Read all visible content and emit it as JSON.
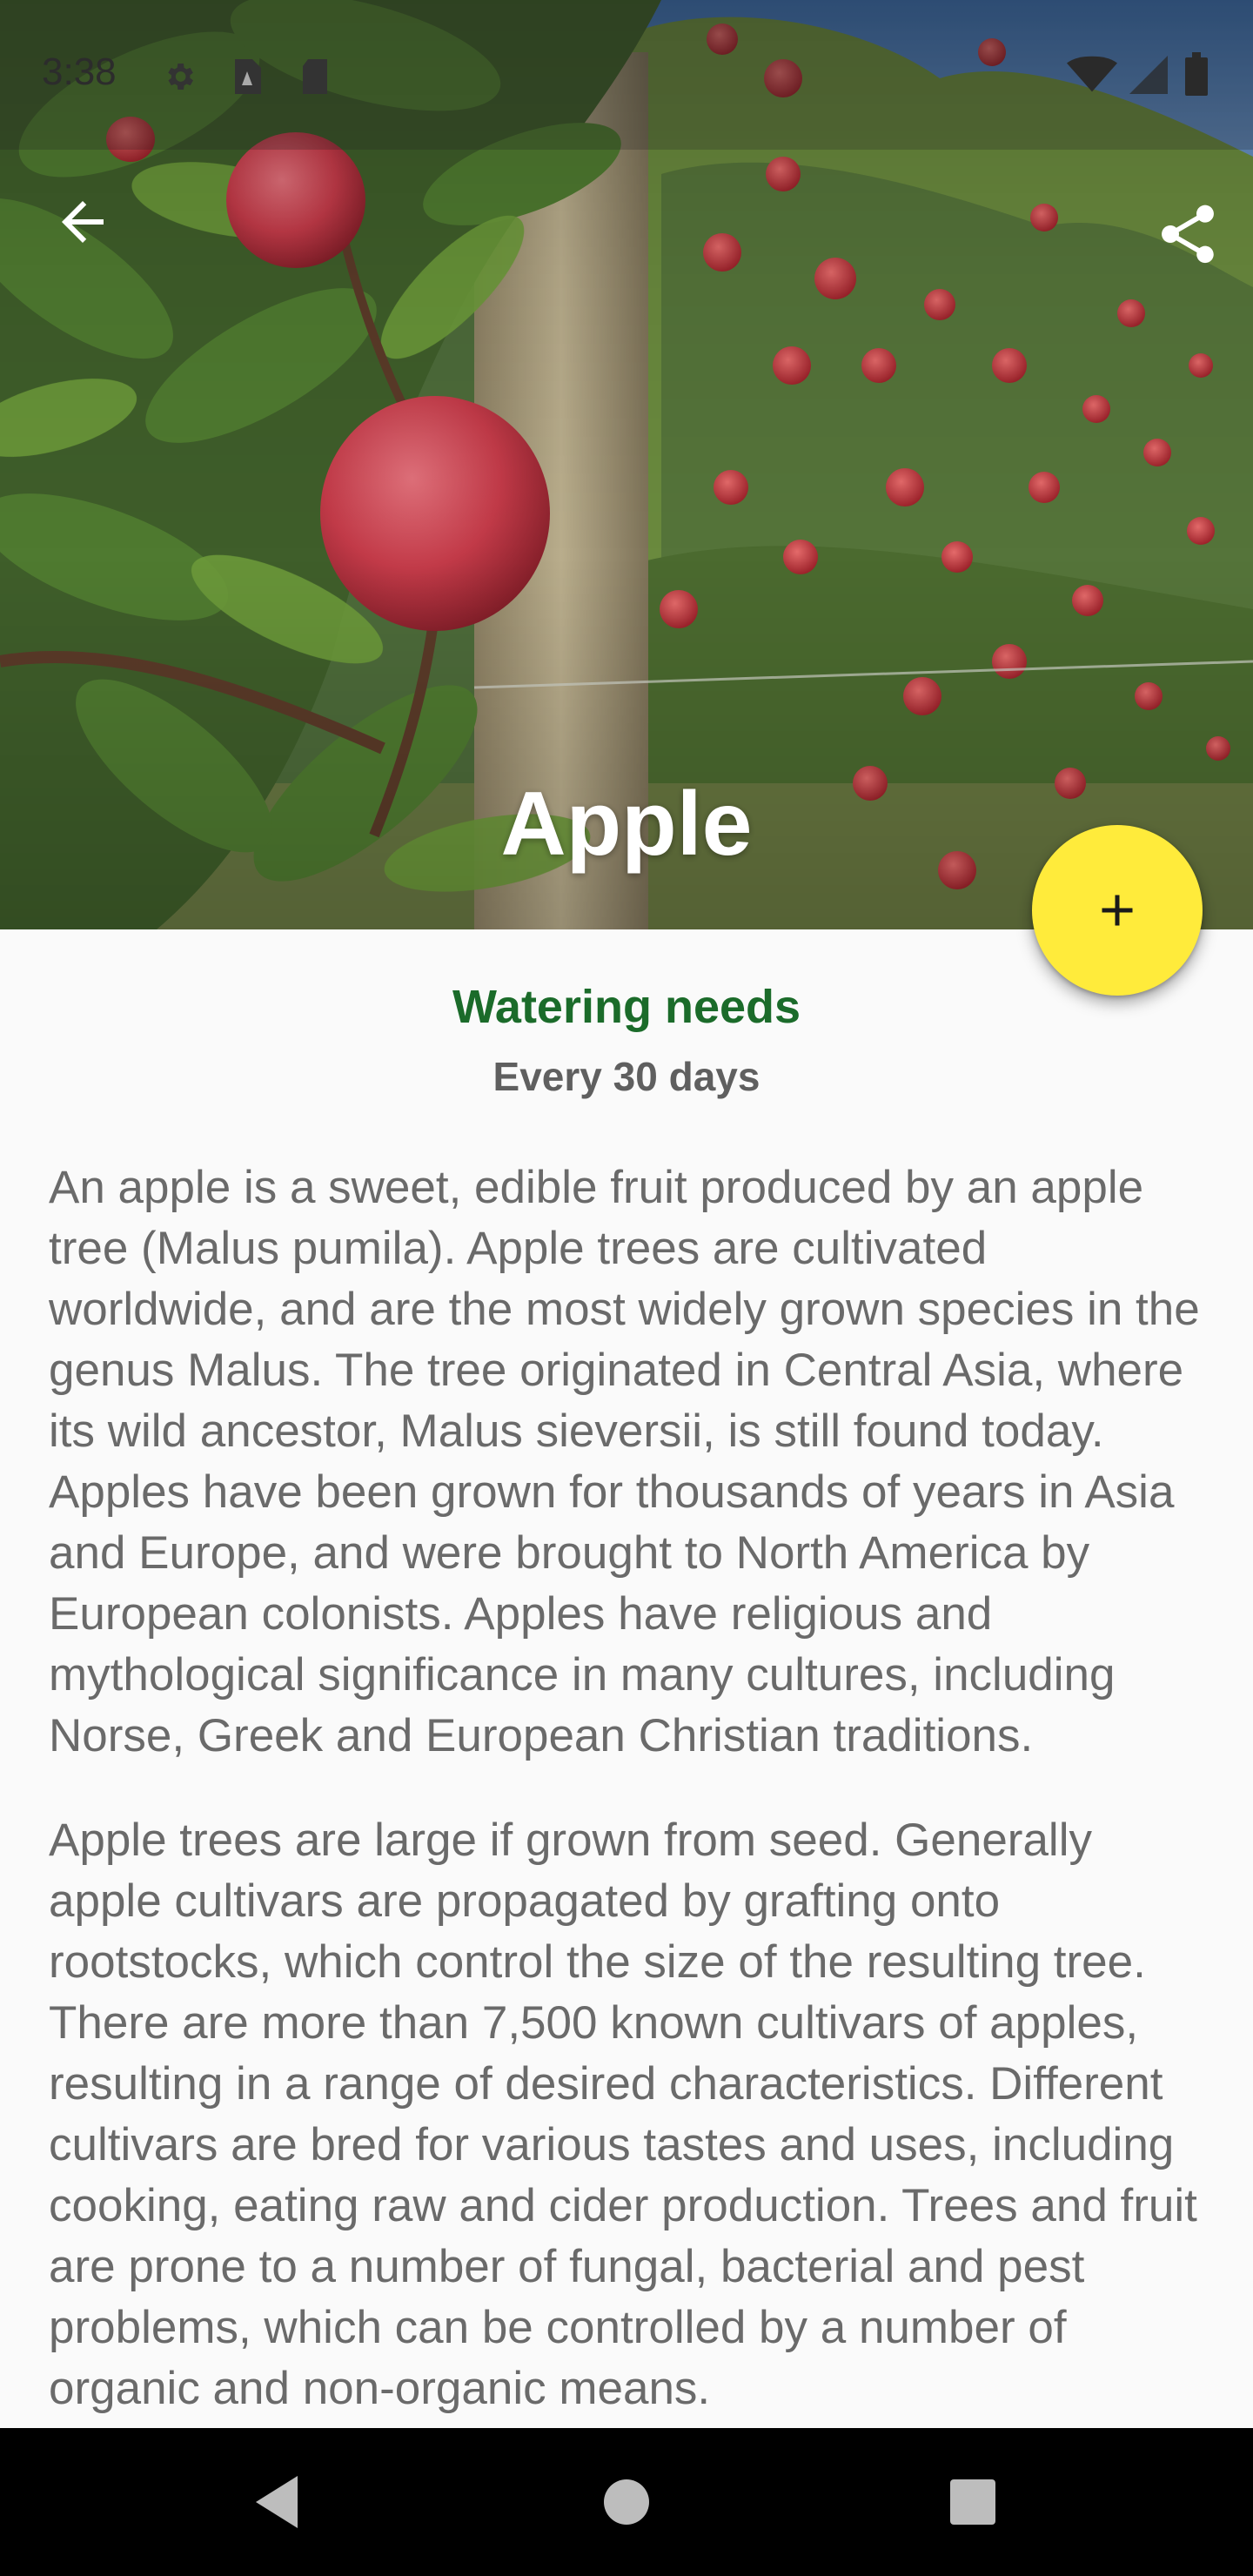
{
  "status_bar": {
    "time": "3:38",
    "icons": [
      "settings-icon",
      "sim-icon",
      "sd-card-icon",
      "wifi-icon",
      "signal-icon",
      "battery-icon"
    ]
  },
  "toolbar": {
    "back_icon": "arrow-back-icon",
    "share_icon": "share-icon"
  },
  "plant": {
    "name": "Apple",
    "image_subject": "apple tree with red apples in an orchard"
  },
  "fab": {
    "icon": "plus-icon",
    "color": "#ffeb3b"
  },
  "watering": {
    "title": "Watering needs",
    "interval": "Every 30 days",
    "title_color": "#1b6b2a"
  },
  "description": {
    "paragraphs": [
      "An apple is a sweet, edible fruit produced by an apple tree (Malus pumila). Apple trees are cultivated worldwide, and are the most widely grown species in the genus Malus. The tree originated in Central Asia, where its wild ancestor, Malus sieversii, is still found today. Apples have been grown for thousands of years in Asia and Europe, and were brought to North America by European colonists. Apples have religious and mythological significance in many cultures, including Norse, Greek and European Christian traditions.",
      "Apple trees are large if grown from seed. Generally apple cultivars are propagated by grafting onto rootstocks, which control the size of the resulting tree. There are more than 7,500 known cultivars of apples, resulting in a range of desired characteristics. Different cultivars are bred for various tastes and uses, including cooking, eating raw and cider production. Trees and fruit are prone to a number of fungal, bacterial and pest problems, which can be controlled by a number of organic and non-organic means."
    ]
  },
  "nav_bar": {
    "buttons": [
      "nav-back-icon",
      "nav-home-icon",
      "nav-recents-icon"
    ]
  }
}
